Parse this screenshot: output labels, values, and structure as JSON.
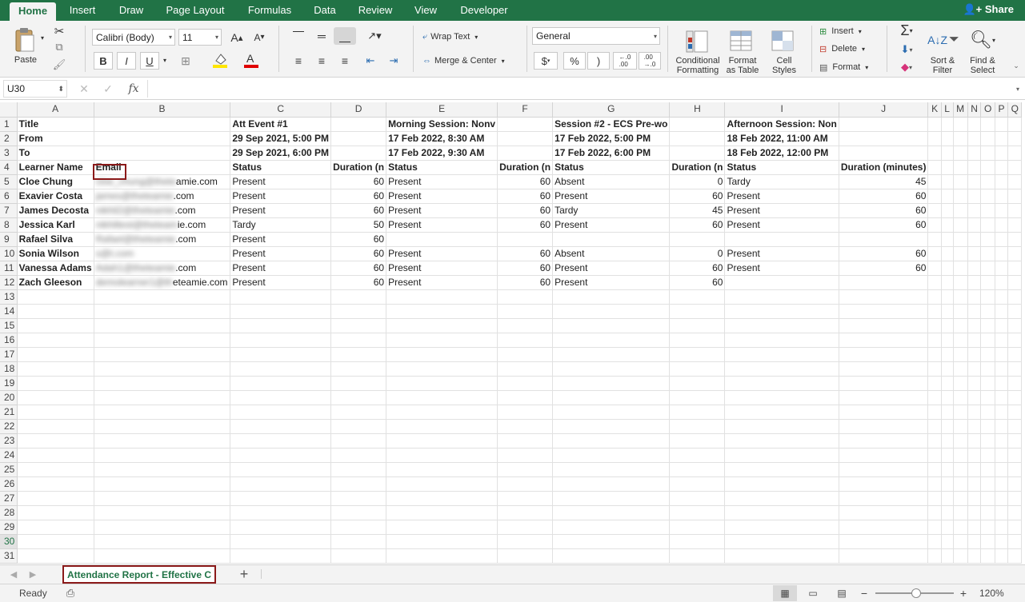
{
  "ribbon_tabs": [
    "Home",
    "Insert",
    "Draw",
    "Page Layout",
    "Formulas",
    "Data",
    "Review",
    "View",
    "Developer"
  ],
  "share_label": "Share",
  "clipboard": {
    "paste": "Paste"
  },
  "font": {
    "name": "Calibri (Body)",
    "size": "11",
    "bold": "B",
    "italic": "I",
    "underline": "U",
    "grow": "A",
    "shrink": "A",
    "color_letter": "A"
  },
  "alignment": {
    "wrap_text": "Wrap Text",
    "merge_center": "Merge & Center"
  },
  "number": {
    "format": "General",
    "currency": "$",
    "percent": "%",
    "comma": ")"
  },
  "styles": {
    "conditional": "Conditional\nFormatting",
    "format_table": "Format\nas Table",
    "cell_styles": "Cell\nStyles"
  },
  "cells": {
    "insert": "Insert",
    "delete": "Delete",
    "format": "Format"
  },
  "editing": {
    "sort": "Sort &\nFilter",
    "find": "Find &\nSelect"
  },
  "name_box": "U30",
  "formula_icon": "fx",
  "columns": [
    "A",
    "B",
    "C",
    "D",
    "E",
    "F",
    "G",
    "H",
    "I",
    "J",
    "K",
    "L",
    "M",
    "N",
    "O",
    "P",
    "Q"
  ],
  "header_rows": [
    [
      "Title",
      "",
      "Att Event #1",
      "",
      "Morning Session: Nonv",
      "",
      "Session #2 - ECS Pre-wo",
      "",
      "Afternoon Session: Non",
      ""
    ],
    [
      "From",
      "",
      "29 Sep 2021, 5:00 PM",
      "",
      "17 Feb 2022, 8:30 AM",
      "",
      "17 Feb 2022, 5:00 PM",
      "",
      "18 Feb 2022, 11:00 AM",
      ""
    ],
    [
      "To",
      "",
      "29 Sep 2021, 6:00 PM",
      "",
      "17 Feb 2022, 9:30 AM",
      "",
      "17 Feb 2022, 6:00 PM",
      "",
      "18 Feb 2022, 12:00 PM",
      ""
    ],
    [
      "Learner Name",
      "Email",
      "Status",
      "Duration (n",
      "Status",
      "Duration (n",
      "Status",
      "Duration (n",
      "Status",
      "Duration (minutes)"
    ]
  ],
  "learners": [
    {
      "name": "Cloe Chung",
      "email_hidden": "cloe_chung@thete",
      "email_visible": "amie.com",
      "vals": [
        "Present",
        "60",
        "Present",
        "60",
        "Absent",
        "0",
        "Tardy",
        "45"
      ]
    },
    {
      "name": "Exavier Costa",
      "email_hidden": "james@theteamie",
      "email_visible": ".com",
      "vals": [
        "Present",
        "60",
        "Present",
        "60",
        "Present",
        "60",
        "Present",
        "60"
      ]
    },
    {
      "name": "James Decosta",
      "email_hidden": "nikhil2@theteamie",
      "email_visible": ".com",
      "vals": [
        "Present",
        "60",
        "Present",
        "60",
        "Tardy",
        "45",
        "Present",
        "60"
      ]
    },
    {
      "name": "Jessica Karl",
      "email_hidden": "nikhiltest@theteam",
      "email_visible": "ie.com",
      "vals": [
        "Tardy",
        "50",
        "Present",
        "60",
        "Present",
        "60",
        "Present",
        "60"
      ]
    },
    {
      "name": "Rafael Silva",
      "email_hidden": "Rafael@theteamie",
      "email_visible": ".com",
      "vals": [
        "Present",
        "60",
        "",
        "",
        "",
        "",
        "",
        ""
      ]
    },
    {
      "name": "Sonia Wilson",
      "email_hidden": "s@t.com",
      "email_visible": "",
      "vals": [
        "Present",
        "60",
        "Present",
        "60",
        "Absent",
        "0",
        "Present",
        "60"
      ]
    },
    {
      "name": "Vanessa Adams",
      "email_hidden": "Adah1@theteamie",
      "email_visible": ".com",
      "vals": [
        "Present",
        "60",
        "Present",
        "60",
        "Present",
        "60",
        "Present",
        "60"
      ]
    },
    {
      "name": "Zach Gleeson",
      "email_hidden": "demolearner1@th",
      "email_visible": "eteamie.com",
      "vals": [
        "Present",
        "60",
        "Present",
        "60",
        "Present",
        "60",
        "",
        ""
      ]
    }
  ],
  "sheet_tab": "Attendance Report - Effective C",
  "add_sheet": "+",
  "status": {
    "ready": "Ready",
    "zoom": "120%"
  }
}
